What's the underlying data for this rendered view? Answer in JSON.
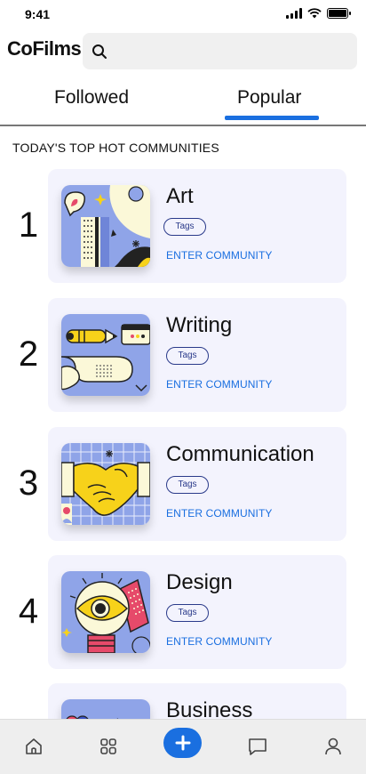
{
  "status_bar": {
    "time": "9:41"
  },
  "header": {
    "app_name": "CoFilms",
    "search": {
      "placeholder": "",
      "value": ""
    }
  },
  "tabs": [
    {
      "label": "Followed",
      "active": false
    },
    {
      "label": "Popular",
      "active": true
    }
  ],
  "section": {
    "title": "TODAY'S TOP HOT COMMUNITIES"
  },
  "communities": [
    {
      "rank": "1",
      "name": "Art",
      "tag": "Tags",
      "cta": "ENTER COMMUNITY"
    },
    {
      "rank": "2",
      "name": "Writing",
      "tag": "Tags",
      "cta": "ENTER COMMUNITY"
    },
    {
      "rank": "3",
      "name": "Communication",
      "tag": "Tags",
      "cta": "ENTER COMMUNITY"
    },
    {
      "rank": "4",
      "name": "Design",
      "tag": "Tags",
      "cta": "ENTER COMMUNITY"
    },
    {
      "rank": "",
      "name": "Business",
      "tag": "",
      "cta": ""
    }
  ],
  "bottom_nav": {
    "items": [
      "home-icon",
      "grid-icon",
      "add-icon",
      "chat-icon",
      "profile-icon"
    ],
    "active": "add-icon"
  },
  "colors": {
    "accent": "#1a6fe0",
    "card_bg": "#f3f3fd",
    "illustration_blue": "#8fa4e8",
    "illustration_cream": "#fbf8d8",
    "illustration_yellow": "#f7d21a"
  }
}
